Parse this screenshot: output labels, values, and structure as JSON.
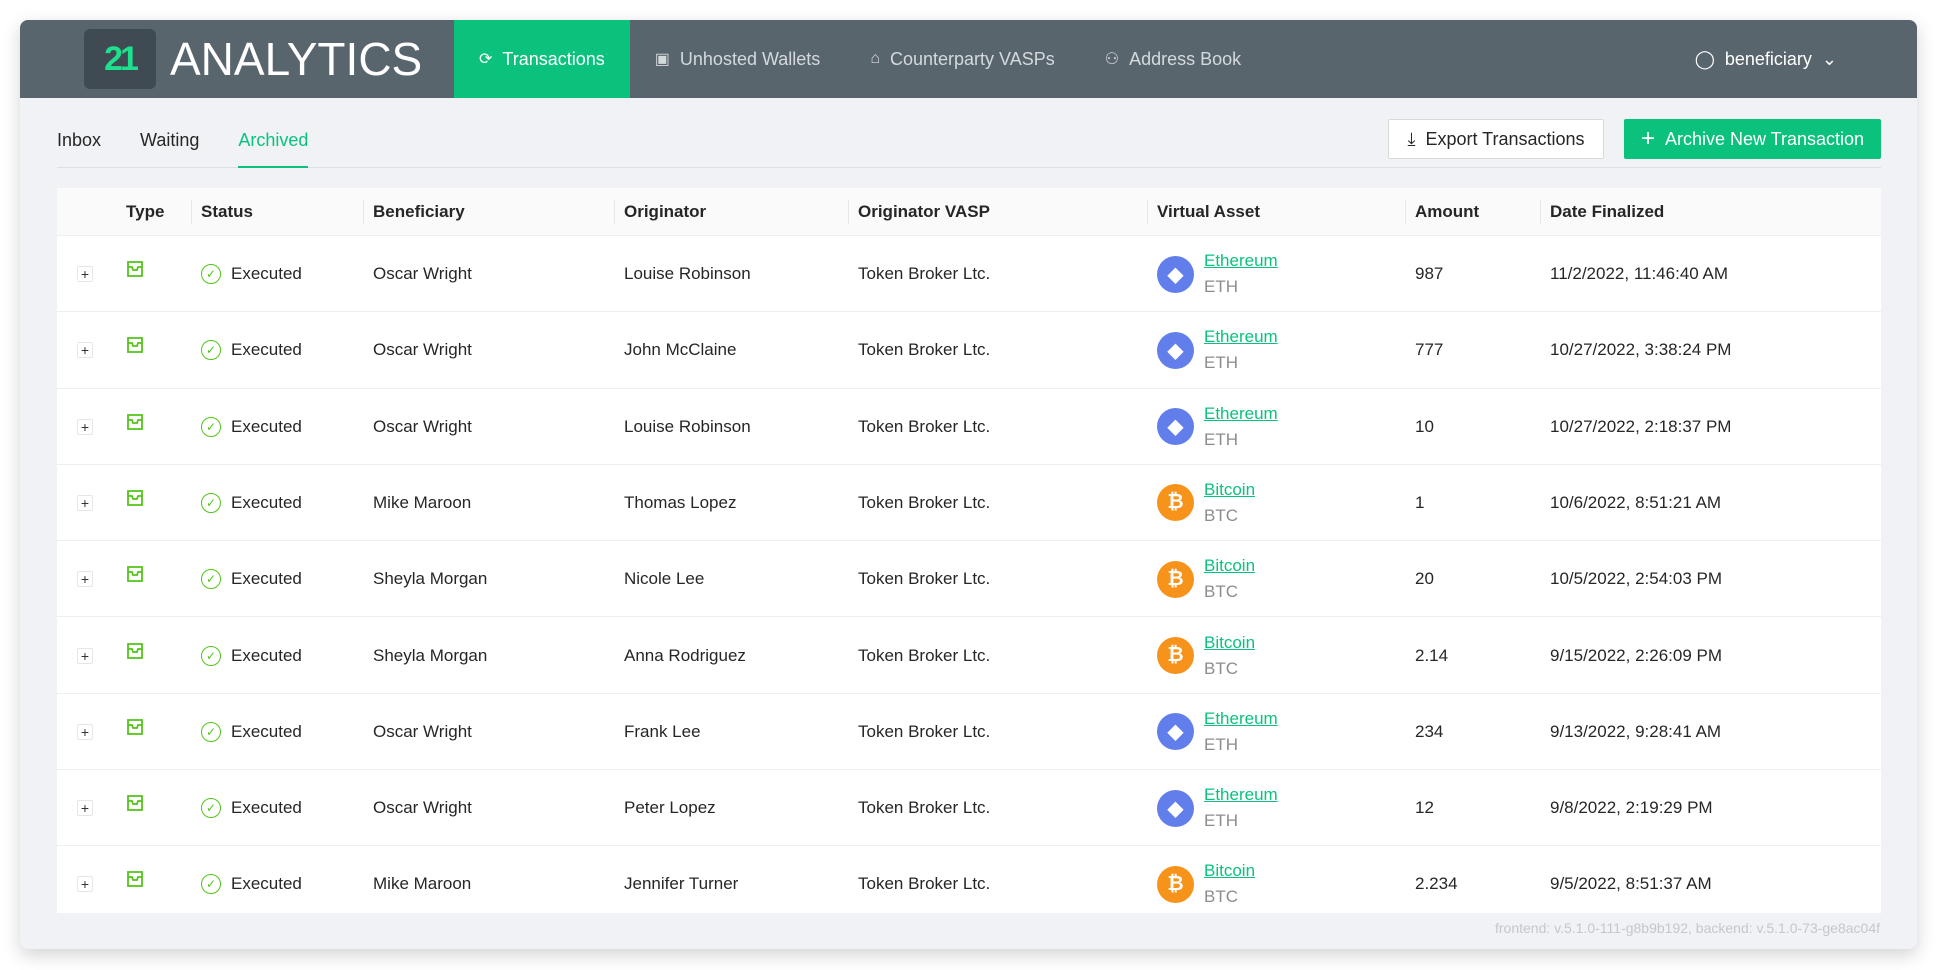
{
  "brand": {
    "logo_mark": "21",
    "name": "ANALYTICS"
  },
  "nav": [
    {
      "label": "Transactions",
      "icon": "transactions-icon",
      "glyph": "⟳",
      "active": true
    },
    {
      "label": "Unhosted Wallets",
      "icon": "wallet-icon",
      "glyph": "▣",
      "active": false
    },
    {
      "label": "Counterparty VASPs",
      "icon": "bank-icon",
      "glyph": "⌂",
      "active": false
    },
    {
      "label": "Address Book",
      "icon": "contacts-icon",
      "glyph": "⚇",
      "active": false
    }
  ],
  "user": {
    "name": "beneficiary",
    "icon": "user-icon",
    "glyph": "⚲"
  },
  "subtabs": [
    {
      "label": "Inbox",
      "active": false
    },
    {
      "label": "Waiting",
      "active": false
    },
    {
      "label": "Archived",
      "active": true
    }
  ],
  "actions": {
    "export_label": "Export Transactions",
    "archive_label": "Archive New Transaction"
  },
  "colors": {
    "accent": "#0bc27d",
    "header": "#59656d",
    "success": "#52c41a",
    "eth": "#627eea",
    "btc": "#f7931a"
  },
  "table": {
    "columns": [
      "Type",
      "Status",
      "Beneficiary",
      "Originator",
      "Originator VASP",
      "Virtual Asset",
      "Amount",
      "Date Finalized"
    ],
    "rows": [
      {
        "status": "Executed",
        "beneficiary": "Oscar Wright",
        "originator": "Louise Robinson",
        "vasp": "Token Broker Ltc.",
        "asset": "Ethereum",
        "symbol": "ETH",
        "amount": "987",
        "date": "11/2/2022, 11:46:40 AM"
      },
      {
        "status": "Executed",
        "beneficiary": "Oscar Wright",
        "originator": "John McClaine",
        "vasp": "Token Broker Ltc.",
        "asset": "Ethereum",
        "symbol": "ETH",
        "amount": "777",
        "date": "10/27/2022, 3:38:24 PM"
      },
      {
        "status": "Executed",
        "beneficiary": "Oscar Wright",
        "originator": "Louise Robinson",
        "vasp": "Token Broker Ltc.",
        "asset": "Ethereum",
        "symbol": "ETH",
        "amount": "10",
        "date": "10/27/2022, 2:18:37 PM"
      },
      {
        "status": "Executed",
        "beneficiary": "Mike Maroon",
        "originator": "Thomas Lopez",
        "vasp": "Token Broker Ltc.",
        "asset": "Bitcoin",
        "symbol": "BTC",
        "amount": "1",
        "date": "10/6/2022, 8:51:21 AM"
      },
      {
        "status": "Executed",
        "beneficiary": "Sheyla Morgan",
        "originator": "Nicole Lee",
        "vasp": "Token Broker Ltc.",
        "asset": "Bitcoin",
        "symbol": "BTC",
        "amount": "20",
        "date": "10/5/2022, 2:54:03 PM"
      },
      {
        "status": "Executed",
        "beneficiary": "Sheyla Morgan",
        "originator": "Anna Rodriguez",
        "vasp": "Token Broker Ltc.",
        "asset": "Bitcoin",
        "symbol": "BTC",
        "amount": "2.14",
        "date": "9/15/2022, 2:26:09 PM"
      },
      {
        "status": "Executed",
        "beneficiary": "Oscar Wright",
        "originator": "Frank Lee",
        "vasp": "Token Broker Ltc.",
        "asset": "Ethereum",
        "symbol": "ETH",
        "amount": "234",
        "date": "9/13/2022, 9:28:41 AM"
      },
      {
        "status": "Executed",
        "beneficiary": "Oscar Wright",
        "originator": "Peter Lopez",
        "vasp": "Token Broker Ltc.",
        "asset": "Ethereum",
        "symbol": "ETH",
        "amount": "12",
        "date": "9/8/2022, 2:19:29 PM"
      },
      {
        "status": "Executed",
        "beneficiary": "Mike Maroon",
        "originator": "Jennifer Turner",
        "vasp": "Token Broker Ltc.",
        "asset": "Bitcoin",
        "symbol": "BTC",
        "amount": "2.234",
        "date": "9/5/2022, 8:51:37 AM"
      }
    ]
  },
  "version": "frontend: v.5.1.0-111-g8b9b192, backend: v.5.1.0-73-ge8ac04f"
}
